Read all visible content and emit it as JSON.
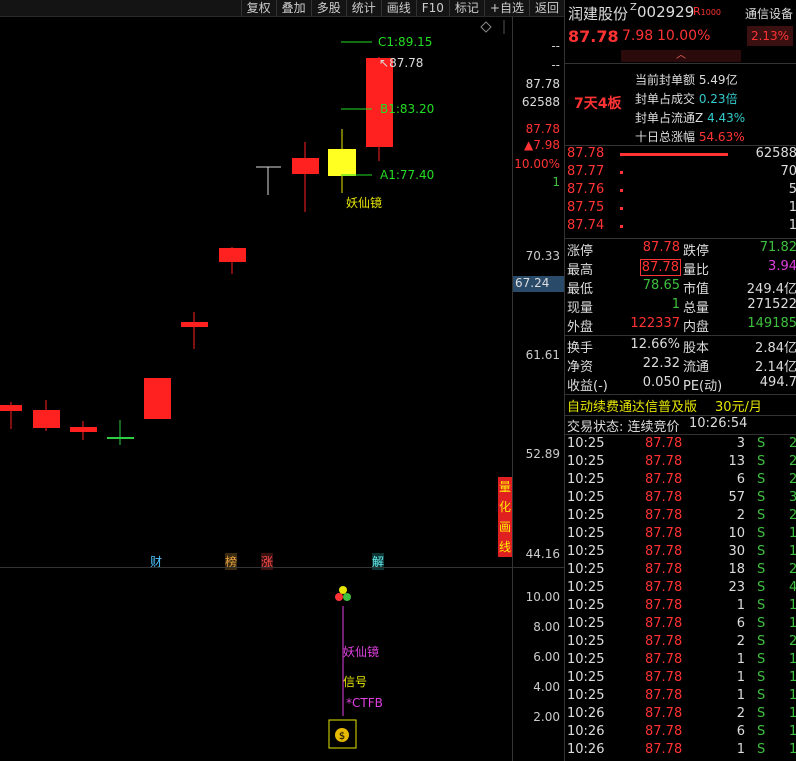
{
  "toolbar": {
    "items": [
      "复权",
      "叠加",
      "多股",
      "统计",
      "画线",
      "F10",
      "标记",
      "+自选",
      "返回"
    ]
  },
  "chart": {
    "axis_labels": [
      "70.33",
      "61.61",
      "52.89",
      "44.16"
    ],
    "axis_current": "67.24",
    "top_dashes": [
      "--",
      "--"
    ],
    "top_price": "87.78",
    "top_volume": "62588",
    "top_price2": "87.78",
    "top_change": "▲7.98",
    "top_pct": "10.00%",
    "top_one": "1",
    "targets": {
      "c1": "C1:89.15",
      "b1": "B1:83.20",
      "a1": "A1:77.40",
      "high_label": "87.78"
    },
    "signal_label": "妖仙镜",
    "markers": [
      "财",
      "榜",
      "涨",
      "解"
    ],
    "vertical_tag": [
      "量",
      "化",
      "画",
      "线"
    ]
  },
  "indicator": {
    "axis_labels": [
      "10.00",
      "8.00",
      "6.00",
      "4.00",
      "2.00"
    ],
    "label1": "妖仙镜",
    "label2": "信号",
    "label3": "*CTFB"
  },
  "stock": {
    "name": "润建股份",
    "code_prefix": "Z",
    "code": "002929",
    "tag": "R",
    "tag2": "1000",
    "broker": "通信设备",
    "broker_pct": "2.13%",
    "price": "87.78",
    "change": "7.98",
    "pct": "10.00%",
    "board_label": "7天4板",
    "board_stats": [
      {
        "label": "当前封单额",
        "value": "5.49亿"
      },
      {
        "label": "封单占成交",
        "value": "0.23倍"
      },
      {
        "label": "封单占流通Z",
        "value": "4.43%"
      },
      {
        "label": "十日总涨幅",
        "value": "54.63%"
      }
    ]
  },
  "orderbook": [
    {
      "price": "87.78",
      "vol": "62588"
    },
    {
      "price": "87.77",
      "vol": "70"
    },
    {
      "price": "87.76",
      "vol": "5"
    },
    {
      "price": "87.75",
      "vol": "1"
    },
    {
      "price": "87.74",
      "vol": "1"
    }
  ],
  "quote": [
    {
      "l1": "涨停",
      "v1": "87.78",
      "l2": "跌停",
      "v2": "71.82"
    },
    {
      "l1": "最高",
      "v1": "87.78",
      "l2": "量比",
      "v2": "3.94"
    },
    {
      "l1": "最低",
      "v1": "78.65",
      "l2": "市值",
      "v2": "249.4亿"
    },
    {
      "l1": "现量",
      "v1": "1",
      "l2": "总量",
      "v2": "271522"
    },
    {
      "l1": "外盘",
      "v1": "122337",
      "l2": "内盘",
      "v2": "149185"
    },
    {
      "l1": "换手",
      "v1": "12.66%",
      "l2": "股本",
      "v2": "2.84亿"
    },
    {
      "l1": "净资",
      "v1": "22.32",
      "l2": "流通",
      "v2": "2.14亿"
    },
    {
      "l1": "收益(-)",
      "v1": "0.050",
      "l2": "PE(动)",
      "v2": "494.7"
    }
  ],
  "promo": {
    "text": "自动续费通达信普及版",
    "price": "30元/月"
  },
  "trade_status": {
    "label": "交易状态: 连续竞价",
    "time": "10:26:54"
  },
  "ticks": [
    {
      "t": "10:25",
      "p": "87.78",
      "v": "3",
      "s": "S",
      "n": "2"
    },
    {
      "t": "10:25",
      "p": "87.78",
      "v": "13",
      "s": "S",
      "n": "2"
    },
    {
      "t": "10:25",
      "p": "87.78",
      "v": "6",
      "s": "S",
      "n": "2"
    },
    {
      "t": "10:25",
      "p": "87.78",
      "v": "57",
      "s": "S",
      "n": "3"
    },
    {
      "t": "10:25",
      "p": "87.78",
      "v": "2",
      "s": "S",
      "n": "2"
    },
    {
      "t": "10:25",
      "p": "87.78",
      "v": "10",
      "s": "S",
      "n": "1"
    },
    {
      "t": "10:25",
      "p": "87.78",
      "v": "30",
      "s": "S",
      "n": "1"
    },
    {
      "t": "10:25",
      "p": "87.78",
      "v": "18",
      "s": "S",
      "n": "2"
    },
    {
      "t": "10:25",
      "p": "87.78",
      "v": "23",
      "s": "S",
      "n": "4"
    },
    {
      "t": "10:25",
      "p": "87.78",
      "v": "1",
      "s": "S",
      "n": "1"
    },
    {
      "t": "10:25",
      "p": "87.78",
      "v": "6",
      "s": "S",
      "n": "1"
    },
    {
      "t": "10:25",
      "p": "87.78",
      "v": "2",
      "s": "S",
      "n": "2"
    },
    {
      "t": "10:25",
      "p": "87.78",
      "v": "1",
      "s": "S",
      "n": "1"
    },
    {
      "t": "10:25",
      "p": "87.78",
      "v": "1",
      "s": "S",
      "n": "1"
    },
    {
      "t": "10:25",
      "p": "87.78",
      "v": "1",
      "s": "S",
      "n": "1"
    },
    {
      "t": "10:26",
      "p": "87.78",
      "v": "2",
      "s": "S",
      "n": "1"
    },
    {
      "t": "10:26",
      "p": "87.78",
      "v": "6",
      "s": "S",
      "n": "1"
    },
    {
      "t": "10:26",
      "p": "87.78",
      "v": "1",
      "s": "S",
      "n": "1"
    }
  ]
}
